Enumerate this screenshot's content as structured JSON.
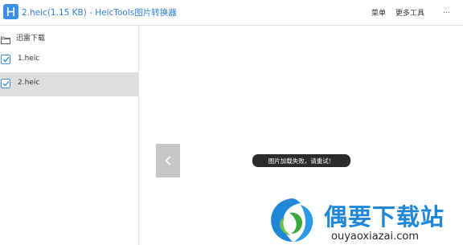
{
  "window": {
    "title": "2.heic(1.15 KB) - HeicTools图片转换器"
  },
  "menu": {
    "main_label": "菜单",
    "tools_label": "更多工具",
    "more_icon": "…"
  },
  "sidebar": {
    "folder_icon": "folder-icon",
    "folder_label": "迅雷下载",
    "files": [
      {
        "name": "1.heic",
        "checked": true,
        "selected": false
      },
      {
        "name": "2.heic",
        "checked": true,
        "selected": true
      }
    ]
  },
  "preview": {
    "prev_icon": "chevron-left-icon",
    "toast_message": "图片加载失败，请重试！"
  },
  "watermark": {
    "title": "偶要下载站",
    "url": "ouyaoxiazai.com",
    "colors": {
      "brand_blue": "#1f86d8",
      "brand_green": "#3aa83a"
    }
  },
  "colors": {
    "accent": "#3d8fe6",
    "title_text": "#2f7fd8",
    "selected_row": "#dedede",
    "nav_button": "#c6c6c6",
    "toast_bg": "#2b2b2b"
  }
}
